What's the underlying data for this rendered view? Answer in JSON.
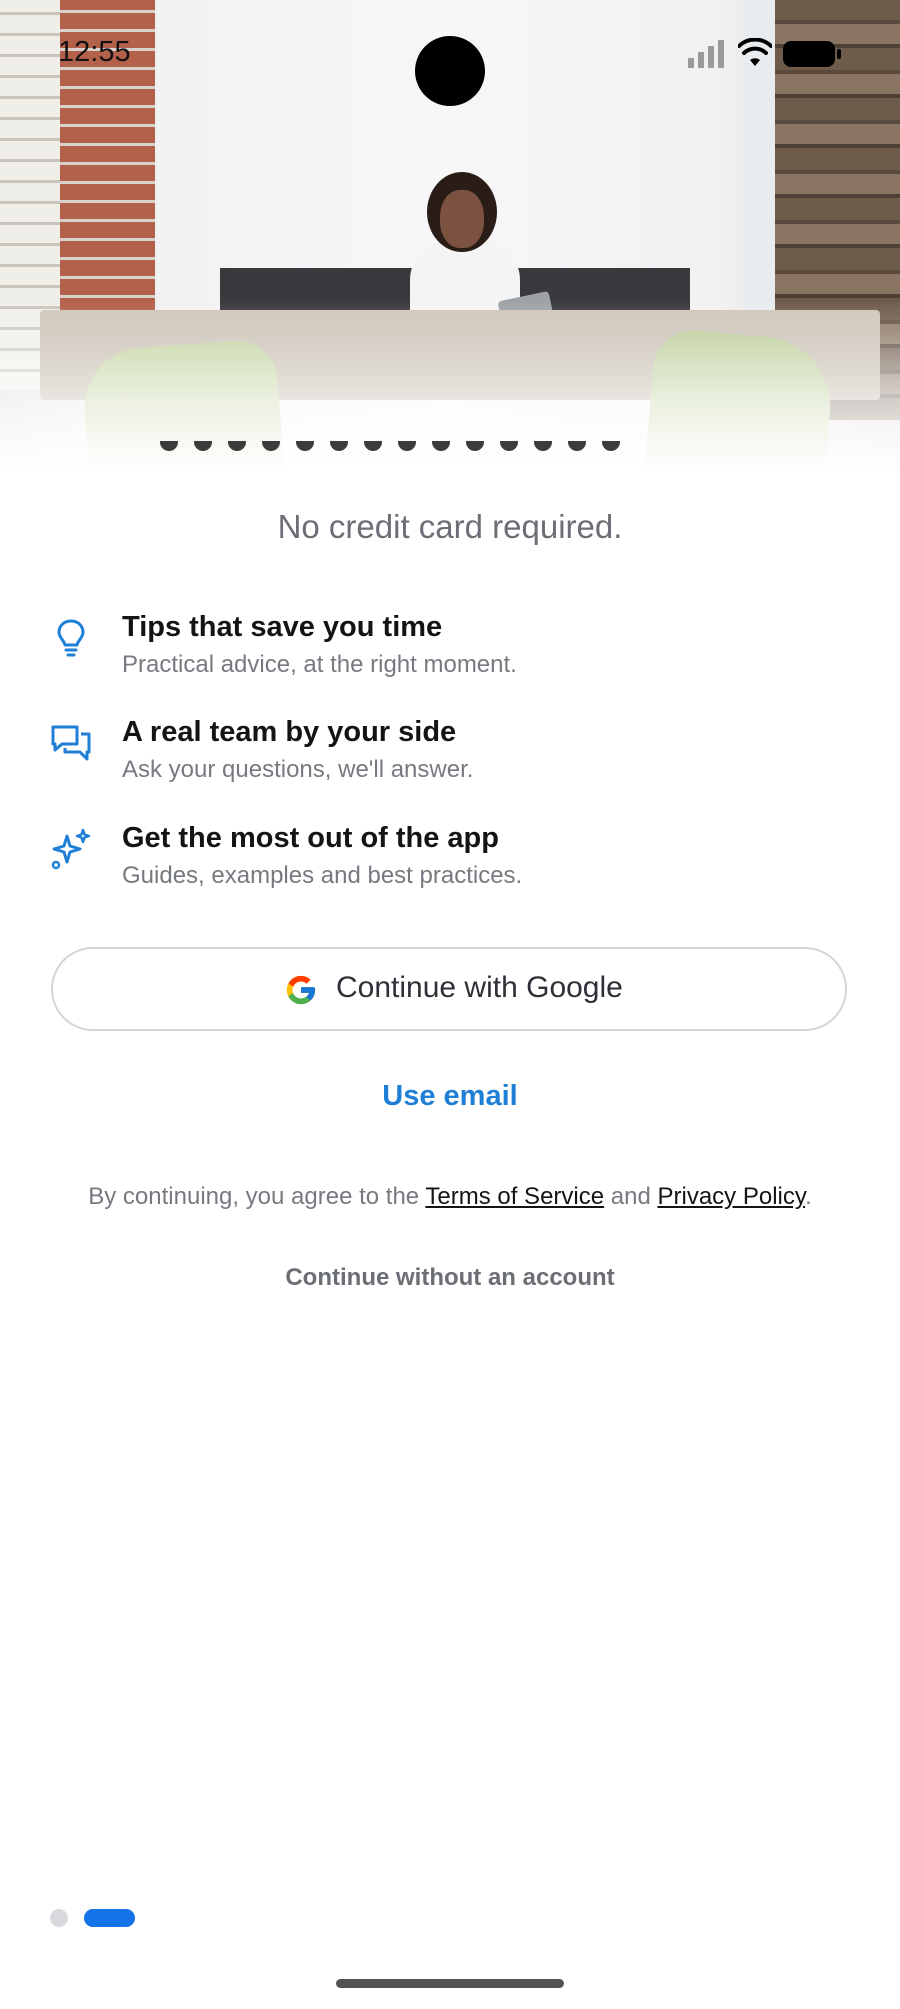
{
  "status_bar": {
    "time": "12:55"
  },
  "hero": {
    "image": "woman-at-office-table-photo"
  },
  "onboarding": {
    "subtitle": "No credit card required.",
    "features": [
      {
        "icon": "lightbulb-icon",
        "title": "Tips that save you time",
        "description": "Practical advice, at the right moment."
      },
      {
        "icon": "chat-bubbles-icon",
        "title": "A real team by your side",
        "description": "Ask your questions, we'll answer."
      },
      {
        "icon": "sparkles-icon",
        "title": "Get the most out of the app",
        "description": "Guides, examples and best practices."
      }
    ],
    "google_button_label": "Continue with Google",
    "use_email_label": "Use email",
    "legal": {
      "prefix": "By continuing, you agree to the ",
      "terms": "Terms of Service",
      "middle": " and ",
      "privacy": "Privacy Policy",
      "suffix": "."
    },
    "guest_label": "Continue without an account"
  },
  "pagination": {
    "current": 2,
    "total": 2
  },
  "colors": {
    "accent": "#1f7ed6",
    "active_dot": "#1473e6",
    "inactive_dot": "#d8d9dc",
    "text_muted": "#767a80"
  }
}
